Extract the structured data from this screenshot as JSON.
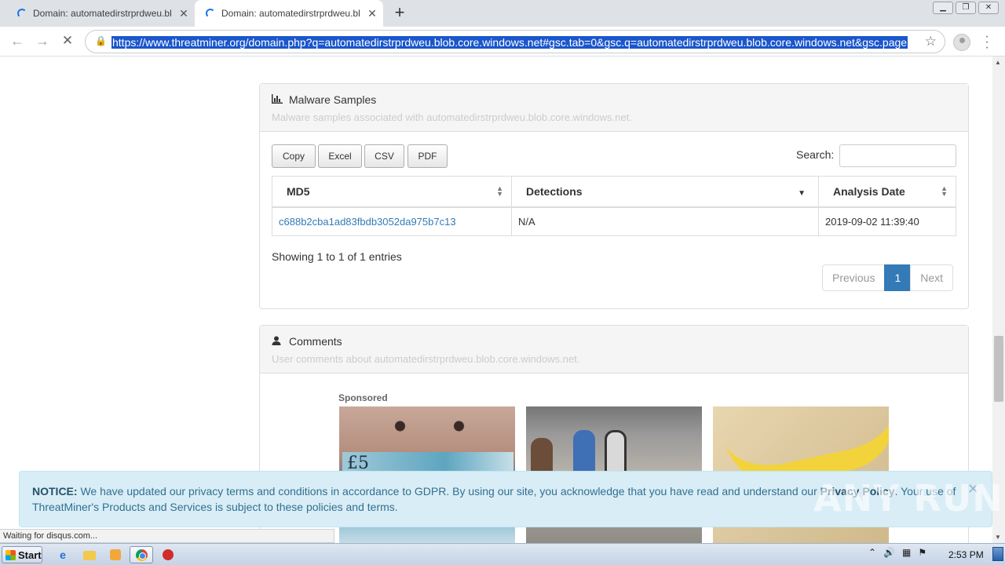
{
  "browser": {
    "tabs": [
      {
        "title": "Domain: automatedirstrprdweu.blob"
      },
      {
        "title": "Domain: automatedirstrprdweu.blob"
      }
    ],
    "url": "https://www.threatminer.org/domain.php?q=automatedirstrprdweu.blob.core.windows.net#gsc.tab=0&gsc.q=automatedirstrprdweu.blob.core.windows.net&gsc.page",
    "status": "Waiting for disqus.com..."
  },
  "malware": {
    "title": "Malware Samples",
    "subtitle": "Malware samples associated with automatedirstrprdweu.blob.core.windows.net.",
    "buttons": {
      "copy": "Copy",
      "excel": "Excel",
      "csv": "CSV",
      "pdf": "PDF"
    },
    "search_label": "Search:",
    "columns": {
      "md5": "MD5",
      "detections": "Detections",
      "analysis_date": "Analysis Date"
    },
    "rows": [
      {
        "md5": "c688b2cba1ad83fbdb3052da975b7c13",
        "detections": "N/A",
        "analysis_date": "2019-09-02 11:39:40"
      }
    ],
    "showing": "Showing 1 to 1 of 1 entries",
    "pager": {
      "previous": "Previous",
      "page": "1",
      "next": "Next"
    }
  },
  "comments": {
    "title": "Comments",
    "subtitle": "User comments about automatedirstrprdweu.blob.core.windows.net.",
    "sponsored": "Sponsored"
  },
  "notice": {
    "label": "NOTICE:",
    "text_before": " We have updated our privacy terms and conditions in accordance to GDPR. By using our site, you acknowledge that you have read and understand our ",
    "link": "Privacy Policy",
    "text_after": ". Your use of ThreatMiner's Products and Services is subject to these policies and terms.",
    "watermark": "ANY RUN"
  },
  "taskbar": {
    "start": "Start",
    "clock": "2:53 PM"
  },
  "colors": {
    "link": "#337ab7",
    "notice_bg": "#d9edf7",
    "notice_text": "#31708f",
    "pager_active": "#337ab7"
  }
}
